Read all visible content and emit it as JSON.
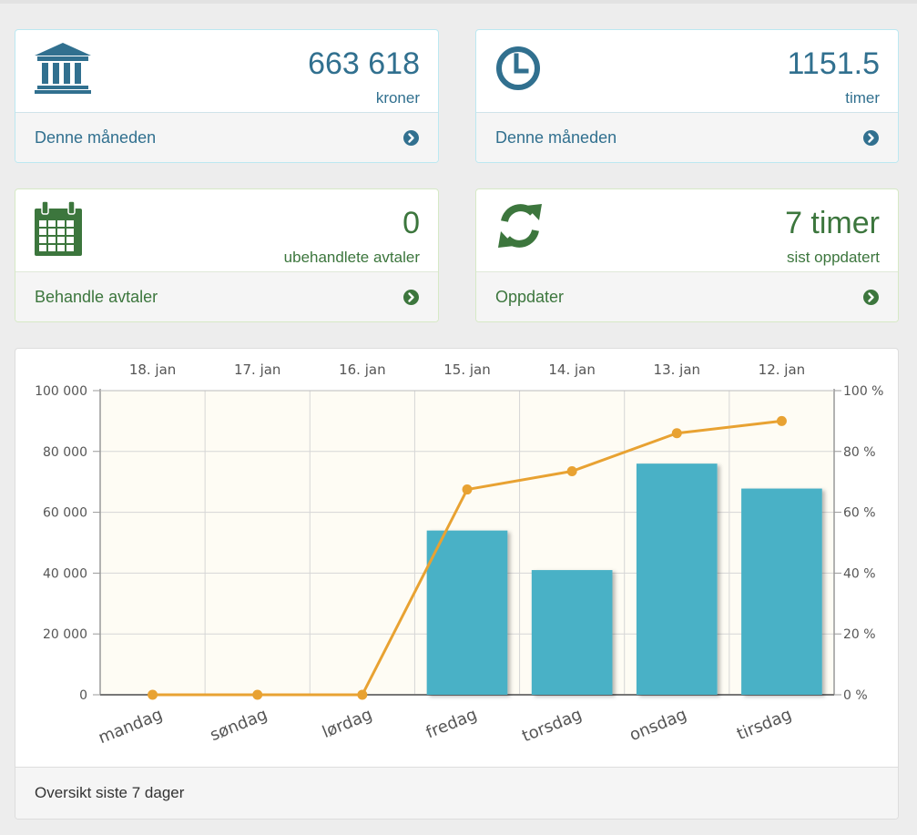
{
  "cards": [
    {
      "value": "663 618",
      "unit": "kroner",
      "link": "Denne måneden",
      "icon": "bank-icon",
      "accent": "#31708f"
    },
    {
      "value": "1151.5",
      "unit": "timer",
      "link": "Denne måneden",
      "icon": "clock-icon",
      "accent": "#31708f"
    },
    {
      "value": "0",
      "unit": "ubehandlete avtaler",
      "link": "Behandle avtaler",
      "icon": "calendar-icon",
      "accent": "#3c763d"
    },
    {
      "value": "7 timer",
      "unit": "sist oppdatert",
      "link": "Oppdater",
      "icon": "refresh-icon",
      "accent": "#3c763d"
    }
  ],
  "chart_panel": {
    "footer": "Oversikt siste 7 dager"
  },
  "chart_data": {
    "type": "bar",
    "categories": [
      "mandag",
      "søndag",
      "lørdag",
      "fredag",
      "torsdag",
      "onsdag",
      "tirsdag"
    ],
    "top_categories": [
      "18. jan",
      "17. jan",
      "16. jan",
      "15. jan",
      "14. jan",
      "13. jan",
      "12. jan"
    ],
    "series": [
      {
        "type": "bar",
        "axis": "left",
        "color": "#4ab1c6",
        "values": [
          0,
          0,
          0,
          54000,
          41000,
          76000,
          67800
        ]
      },
      {
        "type": "line",
        "axis": "right",
        "color": "#e8a232",
        "values": [
          0,
          0,
          0,
          67.5,
          73.5,
          86,
          90
        ]
      }
    ],
    "left_axis": {
      "ylim": [
        0,
        100000
      ],
      "ticks": [
        0,
        20000,
        40000,
        60000,
        80000,
        100000
      ],
      "tick_labels": [
        "0",
        "20 000",
        "40 000",
        "60 000",
        "80 000",
        "100 000"
      ]
    },
    "right_axis": {
      "ylim": [
        0,
        100
      ],
      "ticks": [
        0,
        20,
        40,
        60,
        80,
        100
      ],
      "tick_labels": [
        "0 %",
        "20 %",
        "40 %",
        "60 %",
        "80 %",
        "100 %"
      ]
    },
    "grid": true,
    "plot_background": "#fefcf4"
  }
}
